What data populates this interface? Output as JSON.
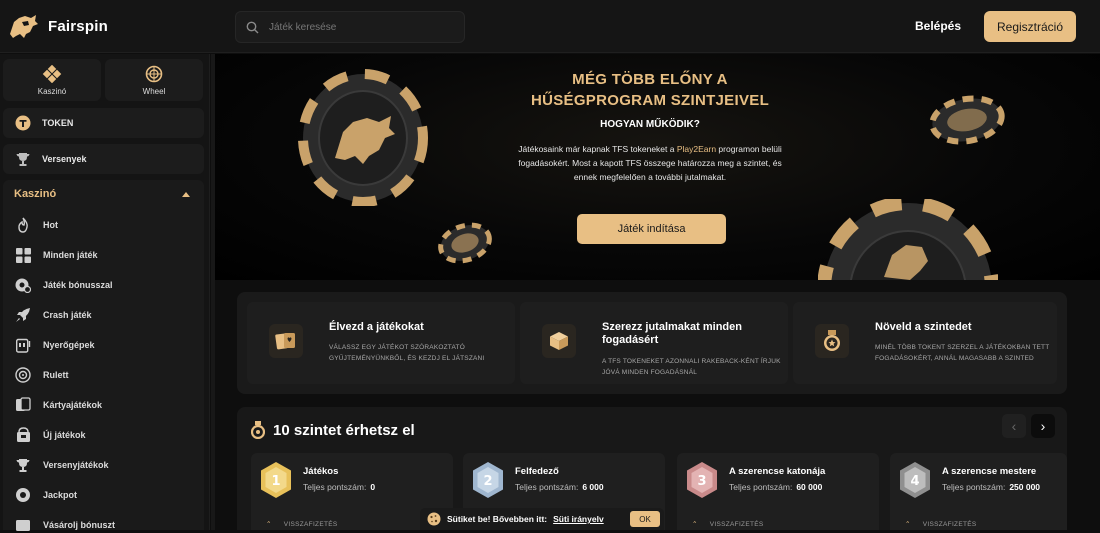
{
  "header": {
    "brand": "Fairspin",
    "search_placeholder": "Játék keresése",
    "login_label": "Belépés",
    "register_label": "Regisztráció"
  },
  "sidebar": {
    "tiles": [
      {
        "label": "Kaszinó",
        "icon": "diamond-cluster-icon"
      },
      {
        "label": "Wheel",
        "icon": "wheel-icon"
      }
    ],
    "token_label": "TOKEN",
    "tournaments_label": "Versenyek",
    "casino_header": "Kaszinó",
    "categories": [
      {
        "label": "Hot",
        "icon": "flame-icon"
      },
      {
        "label": "Minden játék",
        "icon": "grid-icon"
      },
      {
        "label": "Játék bónusszal",
        "icon": "bonus-chip-icon"
      },
      {
        "label": "Crash játék",
        "icon": "rocket-icon"
      },
      {
        "label": "Nyerőgépek",
        "icon": "slot-machine-icon"
      },
      {
        "label": "Rulett",
        "icon": "roulette-icon"
      },
      {
        "label": "Kártyajátékok",
        "icon": "cards-icon"
      },
      {
        "label": "Új játékok",
        "icon": "new-games-icon"
      },
      {
        "label": "Versenyjátékok",
        "icon": "trophy-icon"
      },
      {
        "label": "Jackpot",
        "icon": "jackpot-icon"
      },
      {
        "label": "Vásárolj bónuszt",
        "icon": "buy-bonus-icon"
      }
    ]
  },
  "banner": {
    "title_line1": "MÉG TÖBB ELŐNY A",
    "title_line2": "HŰSÉGPROGRAM SZINTJEIVEL",
    "subtitle": "HOGYAN MŰKÖDIK?",
    "text_before": "Játékosaink már kapnak TFS tokeneket a ",
    "text_accent": "Play2Earn",
    "text_after": " programon belüli fogadásokért. Most a kapott TFS összege határozza meg a szintet, és ennek megfelelően a további jutalmakat.",
    "cta_label": "Játék indítása"
  },
  "features": [
    {
      "title": "Élvezd a játékokat",
      "desc": "Válassz egy játékot szórakoztató gyűjteményünkből, és kezdj el játszani",
      "icon": "cards-icon"
    },
    {
      "title": "Szerezz jutalmakat minden fogadásért",
      "desc": "A TFS tokeneket azonnali rakeback-ként írjuk jóvá minden fogadásnál",
      "icon": "box-icon"
    },
    {
      "title": "Növeld a szintedet",
      "desc": "Minél több tokent szerzel a játékokban tett fogadásokért, annál magasabb a szinted",
      "icon": "medal-icon"
    }
  ],
  "levels": {
    "heading": "10 szintet érhetsz el",
    "points_label": "Teljes pontszám:",
    "footer_label": "VISSZAFIZETÉS",
    "cards": [
      {
        "name": "Játékos",
        "points": "0",
        "number": "1",
        "color": "#e8c15a"
      },
      {
        "name": "Felfedező",
        "points": "6 000",
        "number": "2",
        "color": "#9fb6cf"
      },
      {
        "name": "A szerencse katonája",
        "points": "60 000",
        "number": "3",
        "color": "#c98a8a"
      },
      {
        "name": "A szerencse mestere",
        "points": "250 000",
        "number": "4",
        "color": "#9a9a9a"
      }
    ]
  },
  "cookie": {
    "text": "Sütiket be! Bővebben itt:",
    "link": "Süti irányelv",
    "ok": "OK"
  },
  "colors": {
    "accent": "#e8bf84",
    "background": "#0e0e0e"
  }
}
